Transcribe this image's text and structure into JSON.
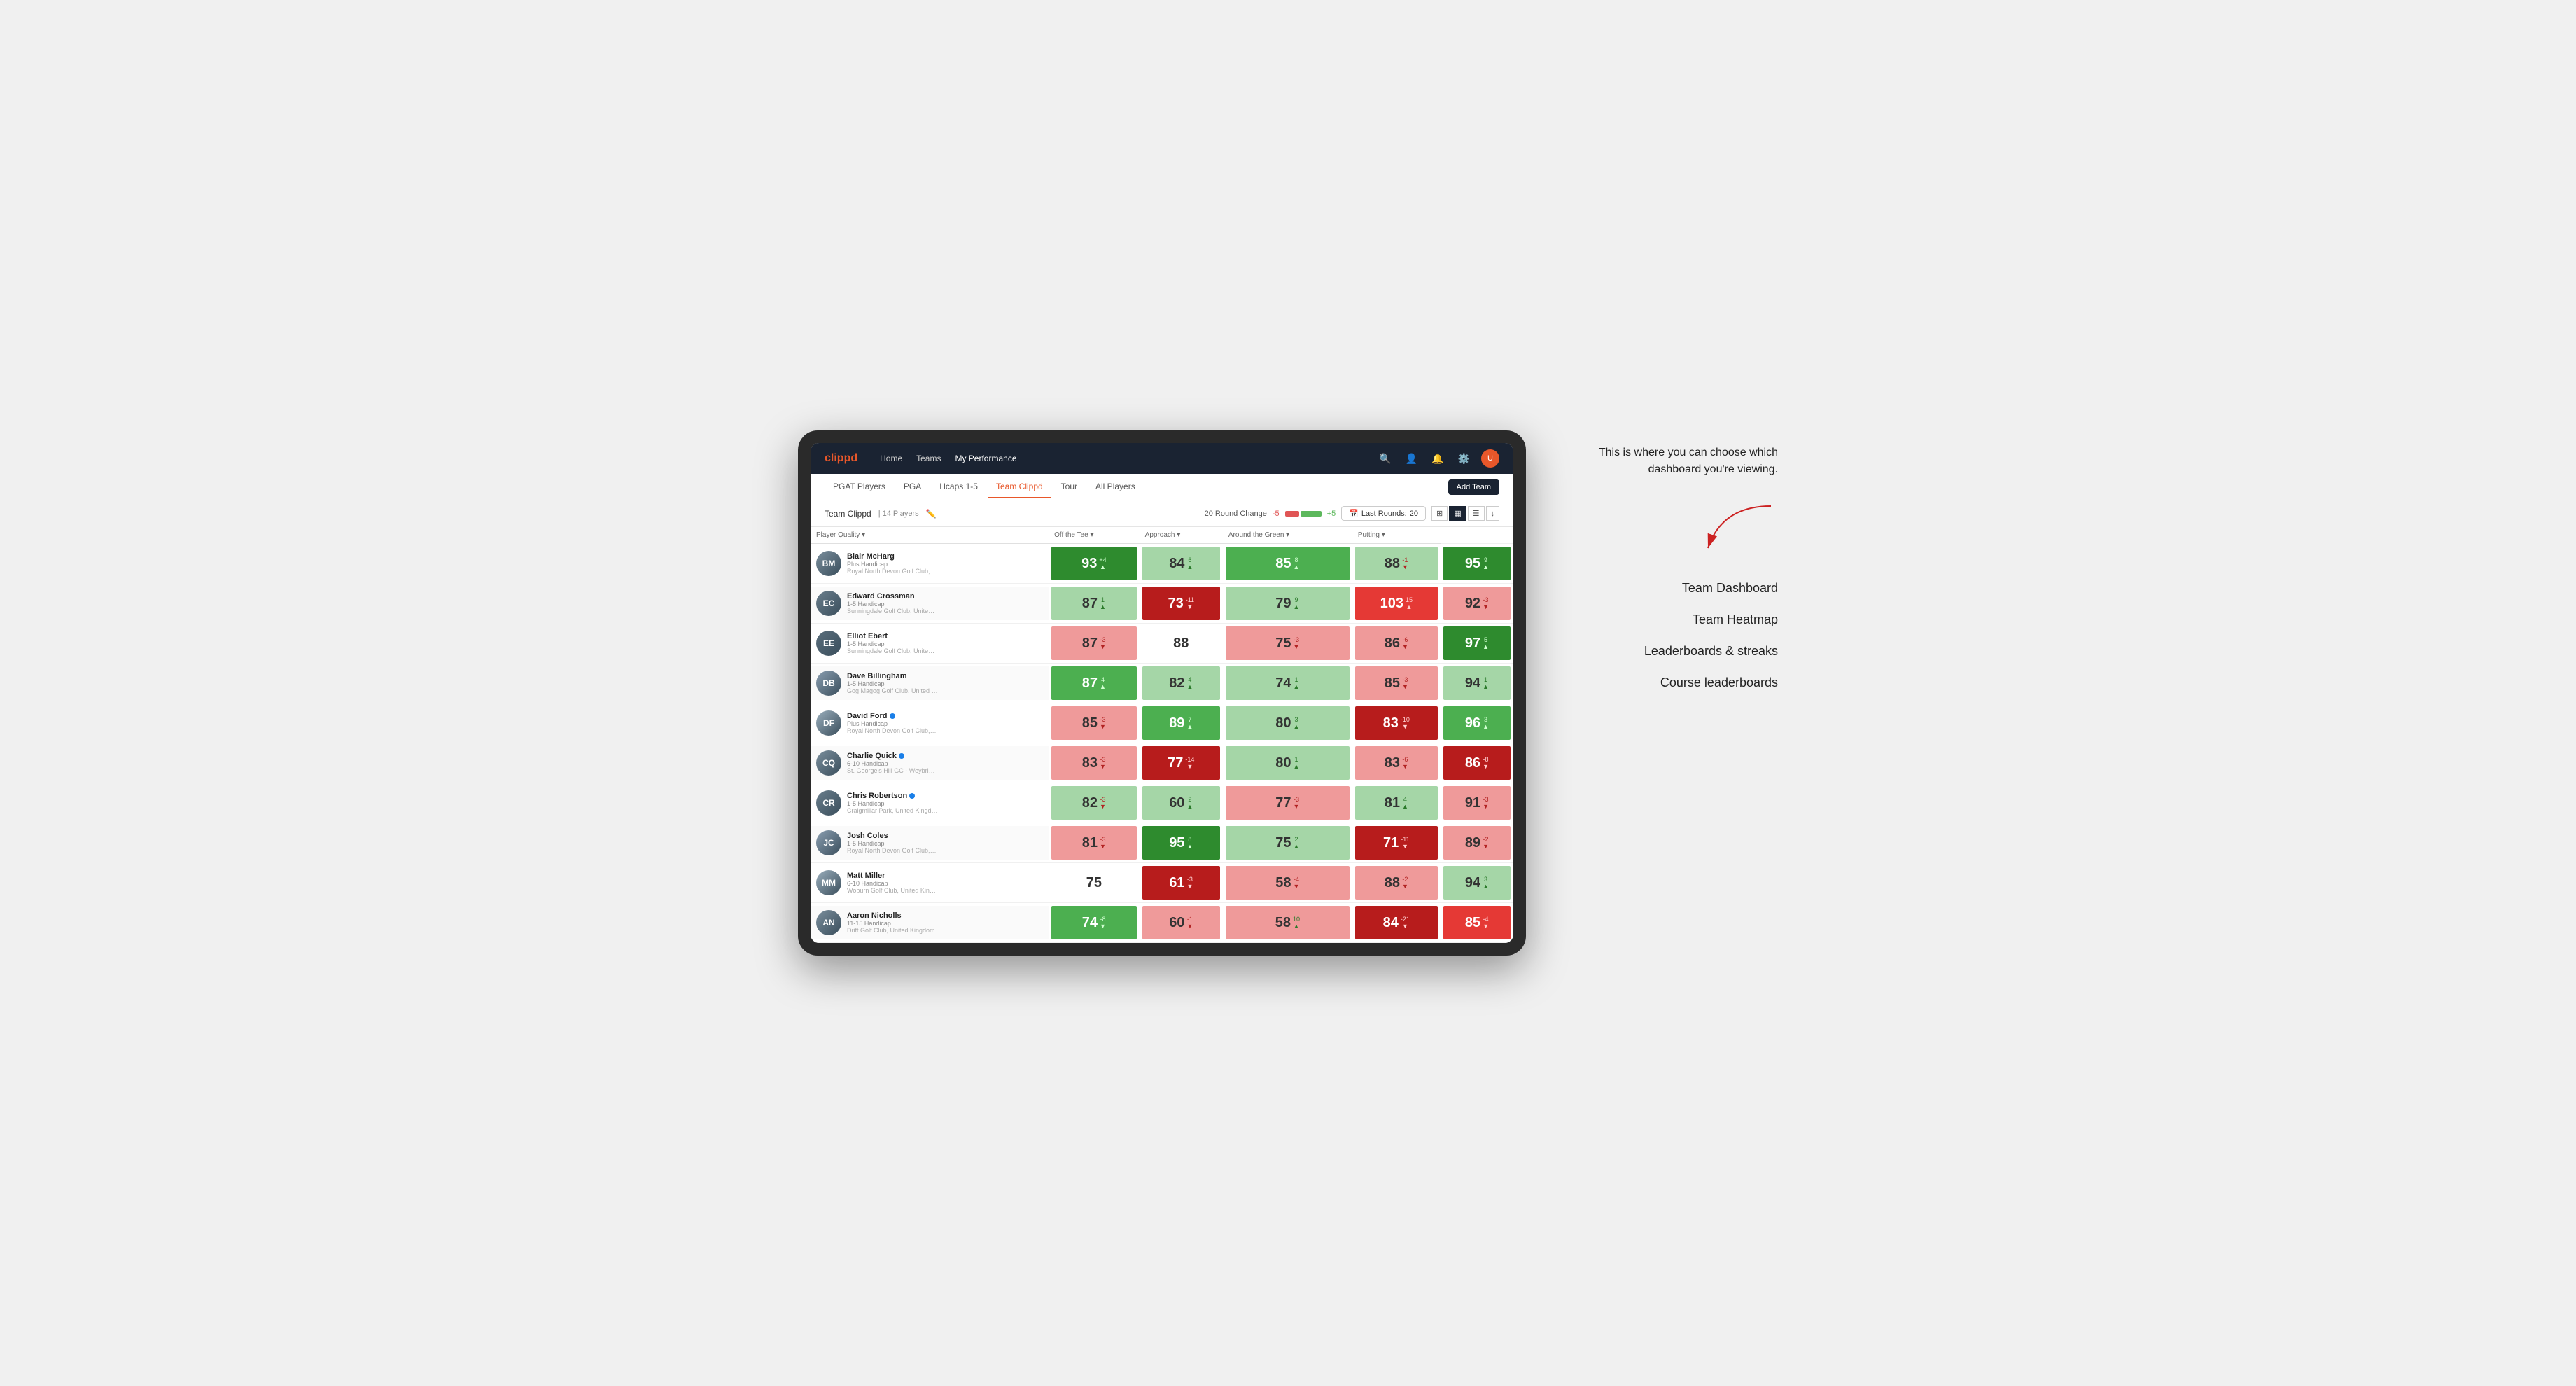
{
  "annotation": {
    "intro_text": "This is where you can choose which dashboard you're viewing.",
    "items": [
      {
        "label": "Team Dashboard"
      },
      {
        "label": "Team Heatmap"
      },
      {
        "label": "Leaderboards & streaks"
      },
      {
        "label": "Course leaderboards"
      }
    ]
  },
  "nav": {
    "logo": "clippd",
    "links": [
      {
        "label": "Home",
        "active": false
      },
      {
        "label": "Teams",
        "active": false
      },
      {
        "label": "My Performance",
        "active": true
      }
    ],
    "icons": [
      "search",
      "person",
      "bell",
      "settings",
      "avatar"
    ]
  },
  "subnav": {
    "links": [
      {
        "label": "PGAT Players",
        "active": false
      },
      {
        "label": "PGA",
        "active": false
      },
      {
        "label": "Hcaps 1-5",
        "active": false
      },
      {
        "label": "Team Clippd",
        "active": true
      },
      {
        "label": "Tour",
        "active": false
      },
      {
        "label": "All Players",
        "active": false
      }
    ],
    "add_team_label": "Add Team"
  },
  "team_header": {
    "name": "Team Clippd",
    "count": "14 Players",
    "round_change_label": "20 Round Change",
    "change_neg": "-5",
    "change_pos": "+5",
    "last_rounds_label": "Last Rounds:",
    "last_rounds_val": "20"
  },
  "table": {
    "columns": [
      {
        "label": "Player Quality ▾",
        "key": "player_quality"
      },
      {
        "label": "Off the Tee ▾",
        "key": "off_tee"
      },
      {
        "label": "Approach ▾",
        "key": "approach"
      },
      {
        "label": "Around the Green ▾",
        "key": "around_green"
      },
      {
        "label": "Putting ▾",
        "key": "putting"
      }
    ],
    "rows": [
      {
        "name": "Blair McHarg",
        "tag": "Plus Handicap",
        "club": "Royal North Devon Golf Club, United Kingdom",
        "initials": "BM",
        "avatarColor": "#7a8e9c",
        "player_quality": {
          "val": 93,
          "change": "+4",
          "dir": "up",
          "bg": "bg-green-dark"
        },
        "off_tee": {
          "val": 84,
          "change": "6",
          "dir": "up",
          "bg": "bg-green-light"
        },
        "approach": {
          "val": 85,
          "change": "8",
          "dir": "up",
          "bg": "bg-green-med"
        },
        "around_green": {
          "val": 88,
          "change": "-1",
          "dir": "down",
          "bg": "bg-green-light"
        },
        "putting": {
          "val": 95,
          "change": "9",
          "dir": "up",
          "bg": "bg-green-dark"
        }
      },
      {
        "name": "Edward Crossman",
        "tag": "1-5 Handicap",
        "club": "Sunningdale Golf Club, United Kingdom",
        "initials": "EC",
        "avatarColor": "#6a7e8c",
        "player_quality": {
          "val": 87,
          "change": "1",
          "dir": "up",
          "bg": "bg-green-light"
        },
        "off_tee": {
          "val": 73,
          "change": "-11",
          "dir": "down",
          "bg": "bg-red-dark"
        },
        "approach": {
          "val": 79,
          "change": "9",
          "dir": "up",
          "bg": "bg-green-light"
        },
        "around_green": {
          "val": 103,
          "change": "15",
          "dir": "up",
          "bg": "bg-red-med"
        },
        "putting": {
          "val": 92,
          "change": "-3",
          "dir": "down",
          "bg": "bg-red-light"
        }
      },
      {
        "name": "Elliot Ebert",
        "tag": "1-5 Handicap",
        "club": "Sunningdale Golf Club, United Kingdom",
        "initials": "EE",
        "avatarColor": "#5a6e7c",
        "player_quality": {
          "val": 87,
          "change": "-3",
          "dir": "down",
          "bg": "bg-red-light"
        },
        "off_tee": {
          "val": 88,
          "change": "",
          "dir": "",
          "bg": "bg-white"
        },
        "approach": {
          "val": 75,
          "change": "-3",
          "dir": "down",
          "bg": "bg-red-light"
        },
        "around_green": {
          "val": 86,
          "change": "-6",
          "dir": "down",
          "bg": "bg-red-light"
        },
        "putting": {
          "val": 97,
          "change": "5",
          "dir": "up",
          "bg": "bg-green-dark"
        }
      },
      {
        "name": "Dave Billingham",
        "tag": "1-5 Handicap",
        "club": "Gog Magog Golf Club, United Kingdom",
        "initials": "DB",
        "avatarColor": "#8a9eb0",
        "player_quality": {
          "val": 87,
          "change": "4",
          "dir": "up",
          "bg": "bg-green-med"
        },
        "off_tee": {
          "val": 82,
          "change": "4",
          "dir": "up",
          "bg": "bg-green-light"
        },
        "approach": {
          "val": 74,
          "change": "1",
          "dir": "up",
          "bg": "bg-green-light"
        },
        "around_green": {
          "val": 85,
          "change": "-3",
          "dir": "down",
          "bg": "bg-red-light"
        },
        "putting": {
          "val": 94,
          "change": "1",
          "dir": "up",
          "bg": "bg-green-light"
        }
      },
      {
        "name": "David Ford",
        "tag": "Plus Handicap",
        "club": "Royal North Devon Golf Club, United Kingdom",
        "initials": "DF",
        "avatarColor": "#9aaebc",
        "verified": true,
        "player_quality": {
          "val": 85,
          "change": "-3",
          "dir": "down",
          "bg": "bg-red-light"
        },
        "off_tee": {
          "val": 89,
          "change": "7",
          "dir": "up",
          "bg": "bg-green-med"
        },
        "approach": {
          "val": 80,
          "change": "3",
          "dir": "up",
          "bg": "bg-green-light"
        },
        "around_green": {
          "val": 83,
          "change": "-10",
          "dir": "down",
          "bg": "bg-red-dark"
        },
        "putting": {
          "val": 96,
          "change": "3",
          "dir": "up",
          "bg": "bg-green-med"
        }
      },
      {
        "name": "Charlie Quick",
        "tag": "6-10 Handicap",
        "club": "St. George's Hill GC - Weybridge - Surrey, Uni...",
        "initials": "CQ",
        "avatarColor": "#7a8e9c",
        "verified": true,
        "player_quality": {
          "val": 83,
          "change": "-3",
          "dir": "down",
          "bg": "bg-red-light"
        },
        "off_tee": {
          "val": 77,
          "change": "-14",
          "dir": "down",
          "bg": "bg-red-dark"
        },
        "approach": {
          "val": 80,
          "change": "1",
          "dir": "up",
          "bg": "bg-green-light"
        },
        "around_green": {
          "val": 83,
          "change": "-6",
          "dir": "down",
          "bg": "bg-red-light"
        },
        "putting": {
          "val": 86,
          "change": "-8",
          "dir": "down",
          "bg": "bg-red-dark"
        }
      },
      {
        "name": "Chris Robertson",
        "tag": "1-5 Handicap",
        "club": "Craigmillar Park, United Kingdom",
        "initials": "CR",
        "avatarColor": "#6a7e8c",
        "verified": true,
        "player_quality": {
          "val": 82,
          "change": "-3",
          "dir": "down",
          "bg": "bg-green-light"
        },
        "off_tee": {
          "val": 60,
          "change": "2",
          "dir": "up",
          "bg": "bg-green-light"
        },
        "approach": {
          "val": 77,
          "change": "-3",
          "dir": "down",
          "bg": "bg-red-light"
        },
        "around_green": {
          "val": 81,
          "change": "4",
          "dir": "up",
          "bg": "bg-green-light"
        },
        "putting": {
          "val": 91,
          "change": "-3",
          "dir": "down",
          "bg": "bg-red-light"
        }
      },
      {
        "name": "Josh Coles",
        "tag": "1-5 Handicap",
        "club": "Royal North Devon Golf Club, United Kingdom",
        "initials": "JC",
        "avatarColor": "#8a9eb0",
        "player_quality": {
          "val": 81,
          "change": "-3",
          "dir": "down",
          "bg": "bg-red-light"
        },
        "off_tee": {
          "val": 95,
          "change": "8",
          "dir": "up",
          "bg": "bg-green-dark"
        },
        "approach": {
          "val": 75,
          "change": "2",
          "dir": "up",
          "bg": "bg-green-light"
        },
        "around_green": {
          "val": 71,
          "change": "-11",
          "dir": "down",
          "bg": "bg-red-dark"
        },
        "putting": {
          "val": 89,
          "change": "-2",
          "dir": "down",
          "bg": "bg-red-light"
        }
      },
      {
        "name": "Matt Miller",
        "tag": "6-10 Handicap",
        "club": "Woburn Golf Club, United Kingdom",
        "initials": "MM",
        "avatarColor": "#9aaebc",
        "player_quality": {
          "val": 75,
          "change": "",
          "dir": "",
          "bg": "bg-white"
        },
        "off_tee": {
          "val": 61,
          "change": "-3",
          "dir": "down",
          "bg": "bg-red-dark"
        },
        "approach": {
          "val": 58,
          "change": "-4",
          "dir": "down",
          "bg": "bg-red-light"
        },
        "around_green": {
          "val": 88,
          "change": "-2",
          "dir": "down",
          "bg": "bg-red-light"
        },
        "putting": {
          "val": 94,
          "change": "3",
          "dir": "up",
          "bg": "bg-green-light"
        }
      },
      {
        "name": "Aaron Nicholls",
        "tag": "11-15 Handicap",
        "club": "Drift Golf Club, United Kingdom",
        "initials": "AN",
        "avatarColor": "#7a8e9c",
        "player_quality": {
          "val": 74,
          "change": "-8",
          "dir": "down",
          "bg": "bg-green-med"
        },
        "off_tee": {
          "val": 60,
          "change": "-1",
          "dir": "down",
          "bg": "bg-red-light"
        },
        "approach": {
          "val": 58,
          "change": "10",
          "dir": "up",
          "bg": "bg-red-light"
        },
        "around_green": {
          "val": 84,
          "change": "-21",
          "dir": "down",
          "bg": "bg-red-dark"
        },
        "putting": {
          "val": 85,
          "change": "-4",
          "dir": "down",
          "bg": "bg-red-med"
        }
      }
    ]
  }
}
